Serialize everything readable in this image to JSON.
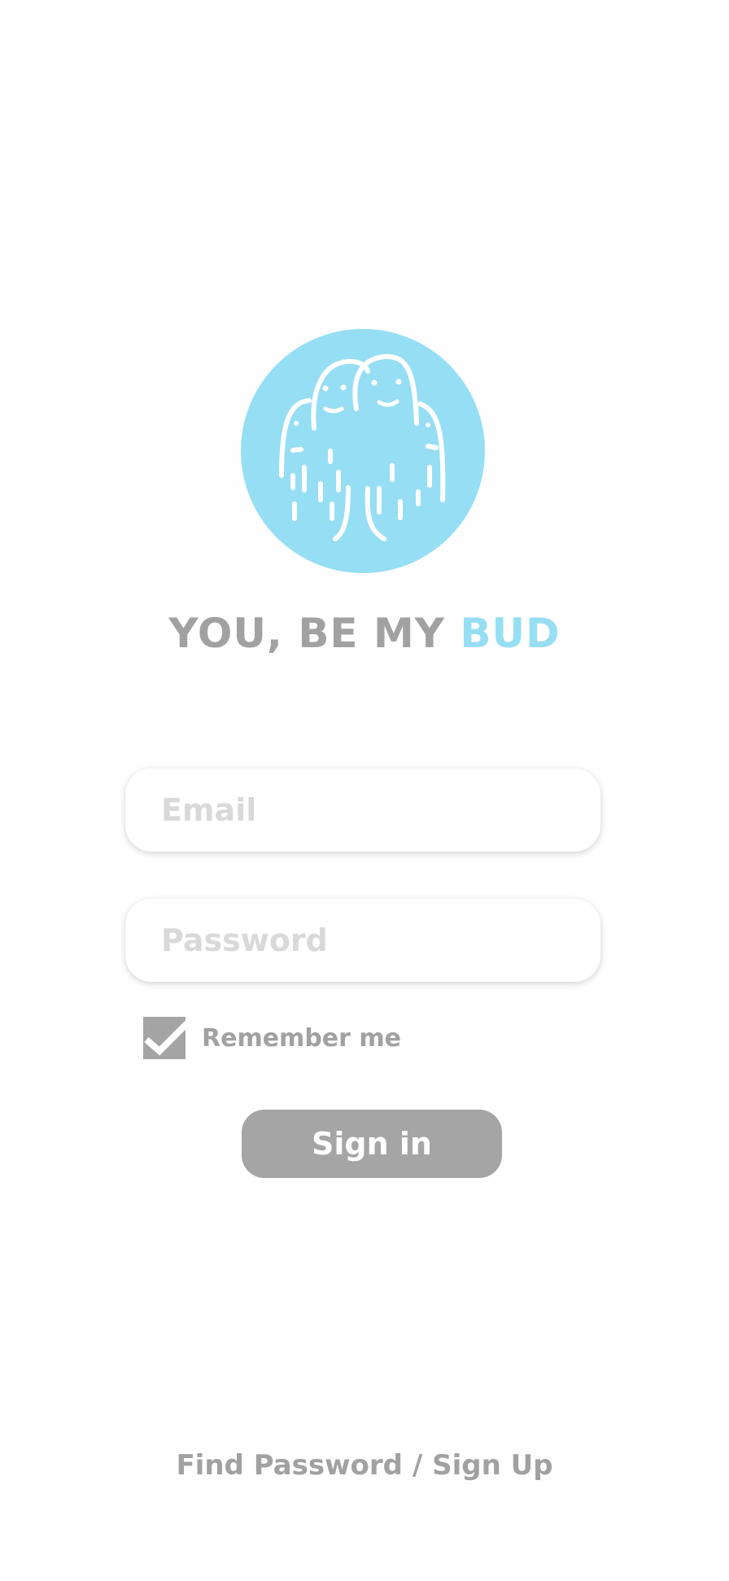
{
  "brand": {
    "title_prefix": "YOU, BE MY ",
    "title_accent": "BUD",
    "logo_icon": "bud-friends-icon",
    "colors": {
      "accent": "#96def4",
      "text_gray": "#a1a1a1",
      "button_gray": "#a5a5a5",
      "placeholder": "#d9d9d9"
    }
  },
  "form": {
    "email": {
      "placeholder": "Email",
      "value": ""
    },
    "password": {
      "placeholder": "Password",
      "value": ""
    },
    "remember": {
      "label": "Remember me",
      "checked": true
    },
    "sign_in_label": "Sign in"
  },
  "footer": {
    "find_password": "Find Password",
    "separator": " / ",
    "sign_up": "Sign Up"
  }
}
